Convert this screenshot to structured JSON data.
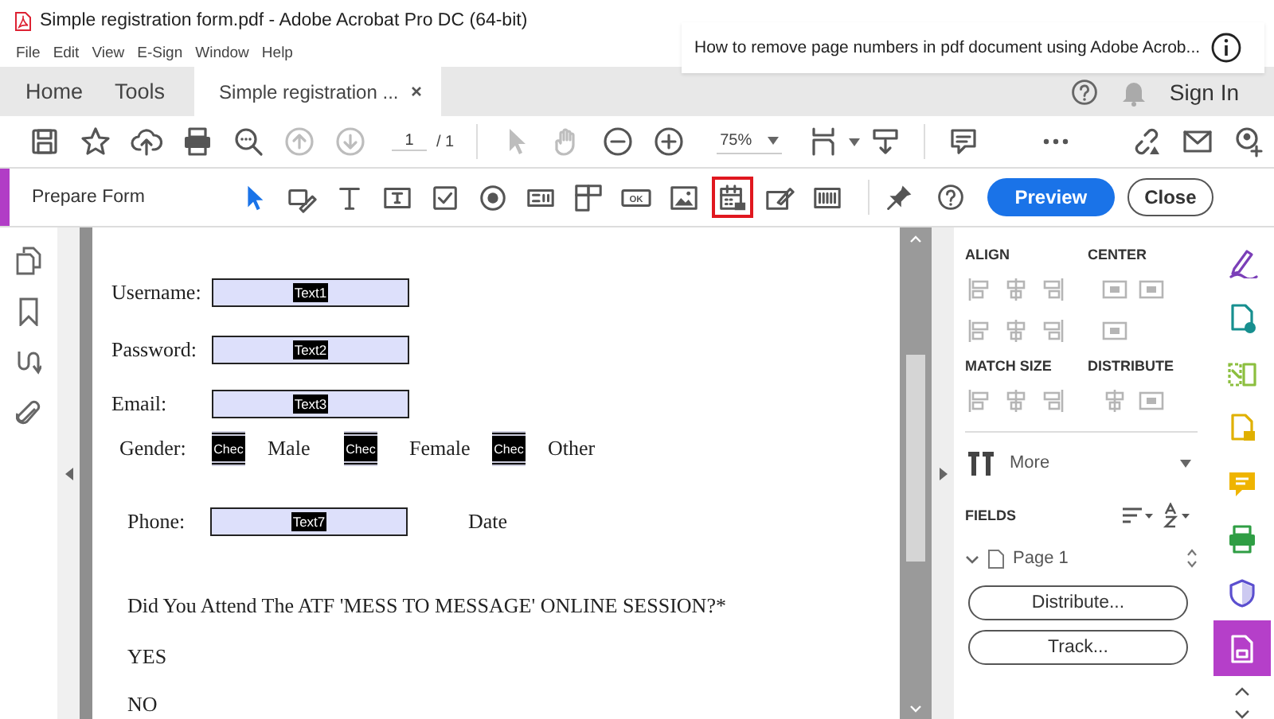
{
  "window": {
    "title": "Simple registration form.pdf - Adobe Acrobat Pro DC (64-bit)"
  },
  "video_overlay": {
    "title": "How to remove page numbers in pdf document using Adobe Acrob..."
  },
  "menu": [
    "File",
    "Edit",
    "View",
    "E-Sign",
    "Window",
    "Help"
  ],
  "tabs": [
    {
      "label": "Home",
      "selected": false,
      "closable": false
    },
    {
      "label": "Tools",
      "selected": false,
      "closable": false
    },
    {
      "label": "Simple registration ...",
      "selected": true,
      "closable": true
    }
  ],
  "account": {
    "sign_in": "Sign In"
  },
  "toolbar": [
    {
      "kind": "save",
      "disabled": false
    },
    {
      "kind": "star",
      "disabled": false
    },
    {
      "kind": "upload",
      "disabled": false
    },
    {
      "kind": "print",
      "disabled": false
    },
    {
      "kind": "search",
      "disabled": false
    },
    {
      "kind": "up",
      "disabled": true
    },
    {
      "kind": "down",
      "disabled": true
    },
    {
      "kind": "page",
      "value": "1",
      "total": "/ 1"
    },
    {
      "kind": "separator"
    },
    {
      "kind": "pointer",
      "disabled": true
    },
    {
      "kind": "hand",
      "disabled": true
    },
    {
      "kind": "zoom-out",
      "disabled": false
    },
    {
      "kind": "zoom-in",
      "disabled": false
    },
    {
      "kind": "zoom",
      "value": "75%"
    },
    {
      "kind": "fit",
      "disabled": false
    },
    {
      "kind": "scroll",
      "disabled": false
    },
    {
      "kind": "separator"
    },
    {
      "kind": "comment",
      "disabled": false
    },
    {
      "kind": "more",
      "disabled": false
    },
    {
      "kind": "link",
      "disabled": false
    },
    {
      "kind": "mail",
      "disabled": false
    },
    {
      "kind": "account",
      "disabled": false
    }
  ],
  "prepare_form": {
    "title": "Prepare Form",
    "tools": [
      {
        "kind": "pointer",
        "selected": true,
        "highlighted": false
      },
      {
        "kind": "edit-field",
        "selected": false,
        "highlighted": false
      },
      {
        "kind": "text",
        "selected": false,
        "highlighted": false
      },
      {
        "kind": "text-field",
        "selected": false,
        "highlighted": false
      },
      {
        "kind": "checkbox",
        "selected": false,
        "highlighted": false
      },
      {
        "kind": "radio",
        "selected": false,
        "highlighted": false
      },
      {
        "kind": "list-box",
        "selected": false,
        "highlighted": false
      },
      {
        "kind": "dropdown",
        "selected": false,
        "highlighted": false
      },
      {
        "kind": "button",
        "label": "OK",
        "selected": false,
        "highlighted": false
      },
      {
        "kind": "image",
        "selected": false,
        "highlighted": false
      },
      {
        "kind": "date",
        "selected": false,
        "highlighted": true
      },
      {
        "kind": "signature",
        "selected": false,
        "highlighted": false
      },
      {
        "kind": "barcode",
        "selected": false,
        "highlighted": false
      }
    ],
    "preview": "Preview",
    "close": "Close"
  },
  "document": {
    "fields": [
      {
        "label": "Username:",
        "name": "Text1"
      },
      {
        "label": "Password:",
        "name": "Text2"
      },
      {
        "label": "Email:",
        "name": "Text3"
      }
    ],
    "gender": {
      "label": "Gender:",
      "options": [
        {
          "box": "Chec",
          "label": "Male"
        },
        {
          "box": "Chec",
          "label": "Female"
        },
        {
          "box": "Chec",
          "label": "Other"
        }
      ]
    },
    "phone": {
      "label": "Phone:",
      "name": "Text7"
    },
    "date_label": "Date",
    "question": "Did You Attend The ATF 'MESS TO MESSAGE' ONLINE SESSION?*",
    "answers": [
      "YES",
      "NO"
    ]
  },
  "right_panel": {
    "align_title": "ALIGN",
    "center_title": "CENTER",
    "match_size_title": "MATCH SIZE",
    "distribute_title": "DISTRIBUTE",
    "more": "More",
    "fields_title": "FIELDS",
    "tree": [
      {
        "label": "Page 1",
        "expanded": true
      }
    ],
    "buttons": [
      "Distribute...",
      "Track..."
    ]
  },
  "tool_rail": [
    {
      "kind": "sign",
      "color": "#7b3fb8",
      "selected": false
    },
    {
      "kind": "export",
      "color": "#178f8f",
      "selected": false
    },
    {
      "kind": "organize",
      "color": "#8cbf3f",
      "selected": false
    },
    {
      "kind": "create",
      "color": "#e0b000",
      "selected": false
    },
    {
      "kind": "comment",
      "color": "#efb400",
      "selected": false
    },
    {
      "kind": "print",
      "color": "#2f9e44",
      "selected": false
    },
    {
      "kind": "protect",
      "color": "#5b4fcf",
      "selected": false
    },
    {
      "kind": "form",
      "color": "#b53fc9",
      "selected": true
    }
  ]
}
